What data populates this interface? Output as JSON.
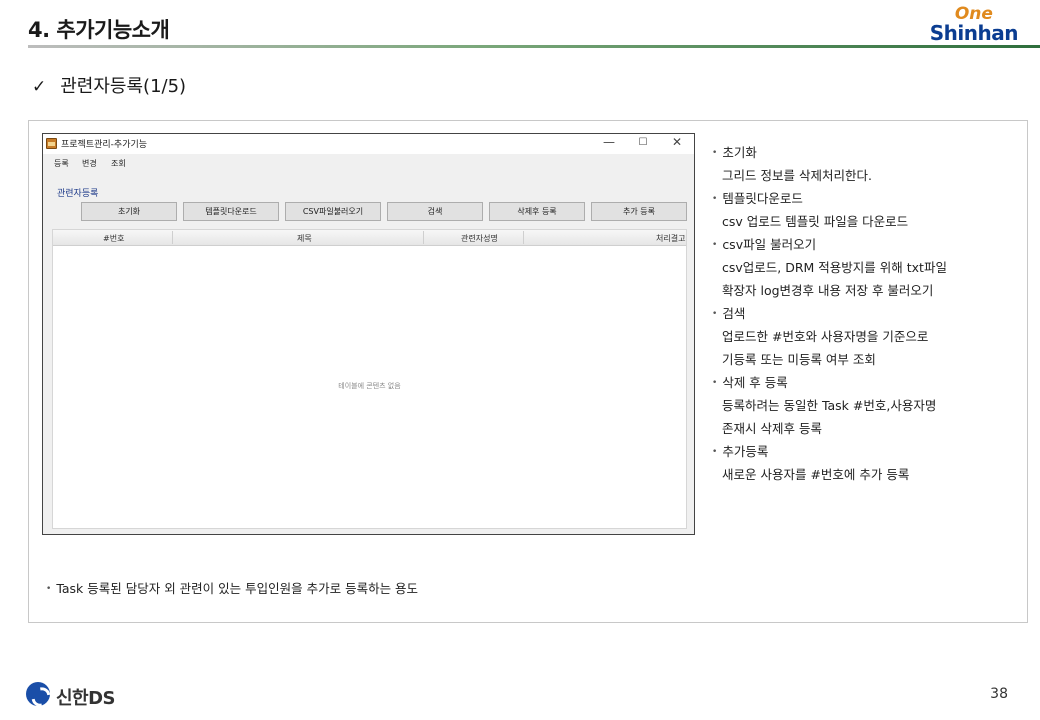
{
  "header": {
    "title": "4. 추가기능소개",
    "logo_top": "One",
    "logo_bottom": "Shinhan"
  },
  "subtitle": {
    "check": "✓",
    "text": "관련자등록(1/5)"
  },
  "app": {
    "window_title": "프로젝트관리-추가기능",
    "controls": {
      "minimize": "—",
      "maximize": "☐",
      "close": "✕"
    },
    "menu": [
      "등록",
      "변경",
      "조회"
    ],
    "panel_label": "관련자등록",
    "buttons": [
      "초기화",
      "템플릿다운로드",
      "CSV파일불러오기",
      "검색",
      "삭제후 등록",
      "추가 등록"
    ],
    "grid": {
      "columns": [
        "#번호",
        "제목",
        "관련자성명",
        "처리결고"
      ],
      "empty_message": "테이블에 콘텐츠 없음"
    }
  },
  "descriptions": [
    {
      "type": "bullet",
      "text": "초기화"
    },
    {
      "type": "sub",
      "text": "그리드 정보를 삭제처리한다."
    },
    {
      "type": "bullet",
      "text": "템플릿다운로드"
    },
    {
      "type": "sub",
      "text": "csv 업로드 템플릿 파일을 다운로드"
    },
    {
      "type": "bullet",
      "text": "csv파일 불러오기"
    },
    {
      "type": "sub",
      "text": "csv업로드, DRM 적용방지를 위해 txt파일"
    },
    {
      "type": "sub",
      "text": "확장자 log변경후 내용 저장 후 불러오기"
    },
    {
      "type": "bullet",
      "text": "검색"
    },
    {
      "type": "sub",
      "text": "업로드한 #번호와 사용자명을 기준으로"
    },
    {
      "type": "sub",
      "text": "기등록 또는 미등록 여부 조회"
    },
    {
      "type": "bullet",
      "text": "삭제 후 등록"
    },
    {
      "type": "sub",
      "text": "등록하려는 동일한 Task #번호,사용자명"
    },
    {
      "type": "sub",
      "text": "존재시 삭제후 등록"
    },
    {
      "type": "bullet",
      "text": "추가등록"
    },
    {
      "type": "sub",
      "text": "새로운 사용자를 #번호에 추가 등록"
    }
  ],
  "note": "Task 등록된 담당자 외 관련이 있는 투입인원을 추가로 등록하는 용도",
  "footer": {
    "brand": "신한DS",
    "page_number": "38"
  }
}
